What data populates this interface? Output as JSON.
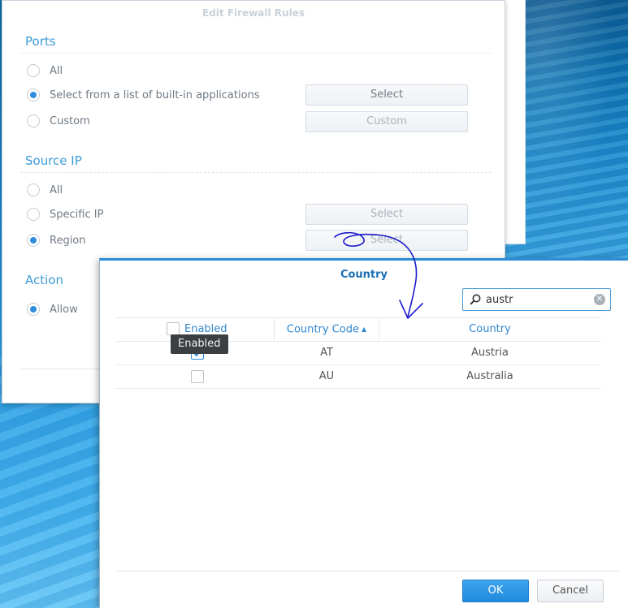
{
  "firewall_dialog": {
    "title": "Edit Firewall Rules",
    "ports": {
      "title": "Ports",
      "options": [
        "All",
        "Select from a list of built-in applications",
        "Custom"
      ],
      "selected": 1,
      "select_button": "Select",
      "custom_button": "Custom"
    },
    "source_ip": {
      "title": "Source IP",
      "options": [
        "All",
        "Specific IP",
        "Region"
      ],
      "selected": 2,
      "specific_select_button": "Select",
      "region_select_button": "Select"
    },
    "action": {
      "title": "Action",
      "options": [
        "Allow"
      ],
      "selected": 0
    }
  },
  "country_dialog": {
    "title": "Country",
    "search": {
      "value": "austr"
    },
    "columns": [
      "Enabled",
      "Country Code",
      "Country"
    ],
    "tooltip": "Enabled",
    "rows": [
      {
        "code": "AT",
        "country": "Austria",
        "enabled": true
      },
      {
        "code": "AU",
        "country": "Australia",
        "enabled": false
      }
    ],
    "ok_label": "OK",
    "cancel_label": "Cancel"
  },
  "colors": {
    "accent": "#2f8ede",
    "section_title": "#3c9bd9",
    "annotation": "#1a1acc"
  }
}
